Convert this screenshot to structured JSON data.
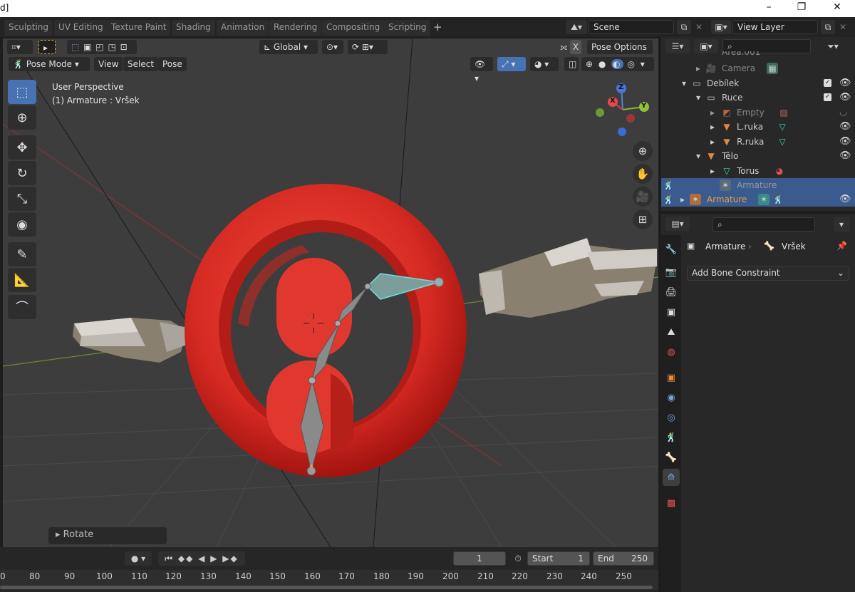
{
  "title_bar": {
    "title": "d]",
    "minimize": "–",
    "restore": "❐",
    "close": "✕"
  },
  "workspace_tabs": [
    "Sculpting",
    "UV Editing",
    "Texture Paint",
    "Shading",
    "Animation",
    "Rendering",
    "Compositing",
    "Scripting"
  ],
  "add_tab": "+",
  "scene": {
    "label": "Scene",
    "view_layer": "View Layer"
  },
  "viewport": {
    "transform_orientation": "Global",
    "pose_options": "Pose Options",
    "mode": "Pose Mode",
    "menus": [
      "View",
      "Select",
      "Pose"
    ],
    "perspective_label": "User Perspective",
    "active_object": "(1) Armature : Vršek",
    "gizmo_axes": {
      "x": "X",
      "y": "Y",
      "z": "Z"
    },
    "x_mirror": "X"
  },
  "operator_panel": {
    "label": "Rotate"
  },
  "timeline": {
    "current_frame": "1",
    "start_label": "Start",
    "start_value": "1",
    "end_label": "End",
    "end_value": "250",
    "ruler": [
      "0",
      "80",
      "90",
      "100",
      "110",
      "120",
      "130",
      "140",
      "150",
      "160",
      "170",
      "180",
      "190",
      "200",
      "210",
      "220",
      "230",
      "240",
      "250"
    ]
  },
  "outliner": {
    "items": [
      {
        "label": "Area.001",
        "dim": true
      },
      {
        "label": "Camera",
        "dim": true
      },
      {
        "label": "Debílek"
      },
      {
        "label": "Ruce"
      },
      {
        "label": "Empty",
        "dim": true
      },
      {
        "label": "L.ruka"
      },
      {
        "label": "R.ruka"
      },
      {
        "label": "Tělo"
      },
      {
        "label": "Torus"
      },
      {
        "label": "Armature",
        "dim": true
      },
      {
        "label": "Armature"
      }
    ]
  },
  "properties": {
    "breadcrumb_object": "Armature",
    "breadcrumb_bone": "Vršek",
    "add_constraint": "Add Bone Constraint"
  },
  "colors": {
    "accent_blue": "#4772b3",
    "torus_red": "#e0302a",
    "selected_row": "#3b5a8e",
    "armature_orange": "#e6a04a"
  }
}
